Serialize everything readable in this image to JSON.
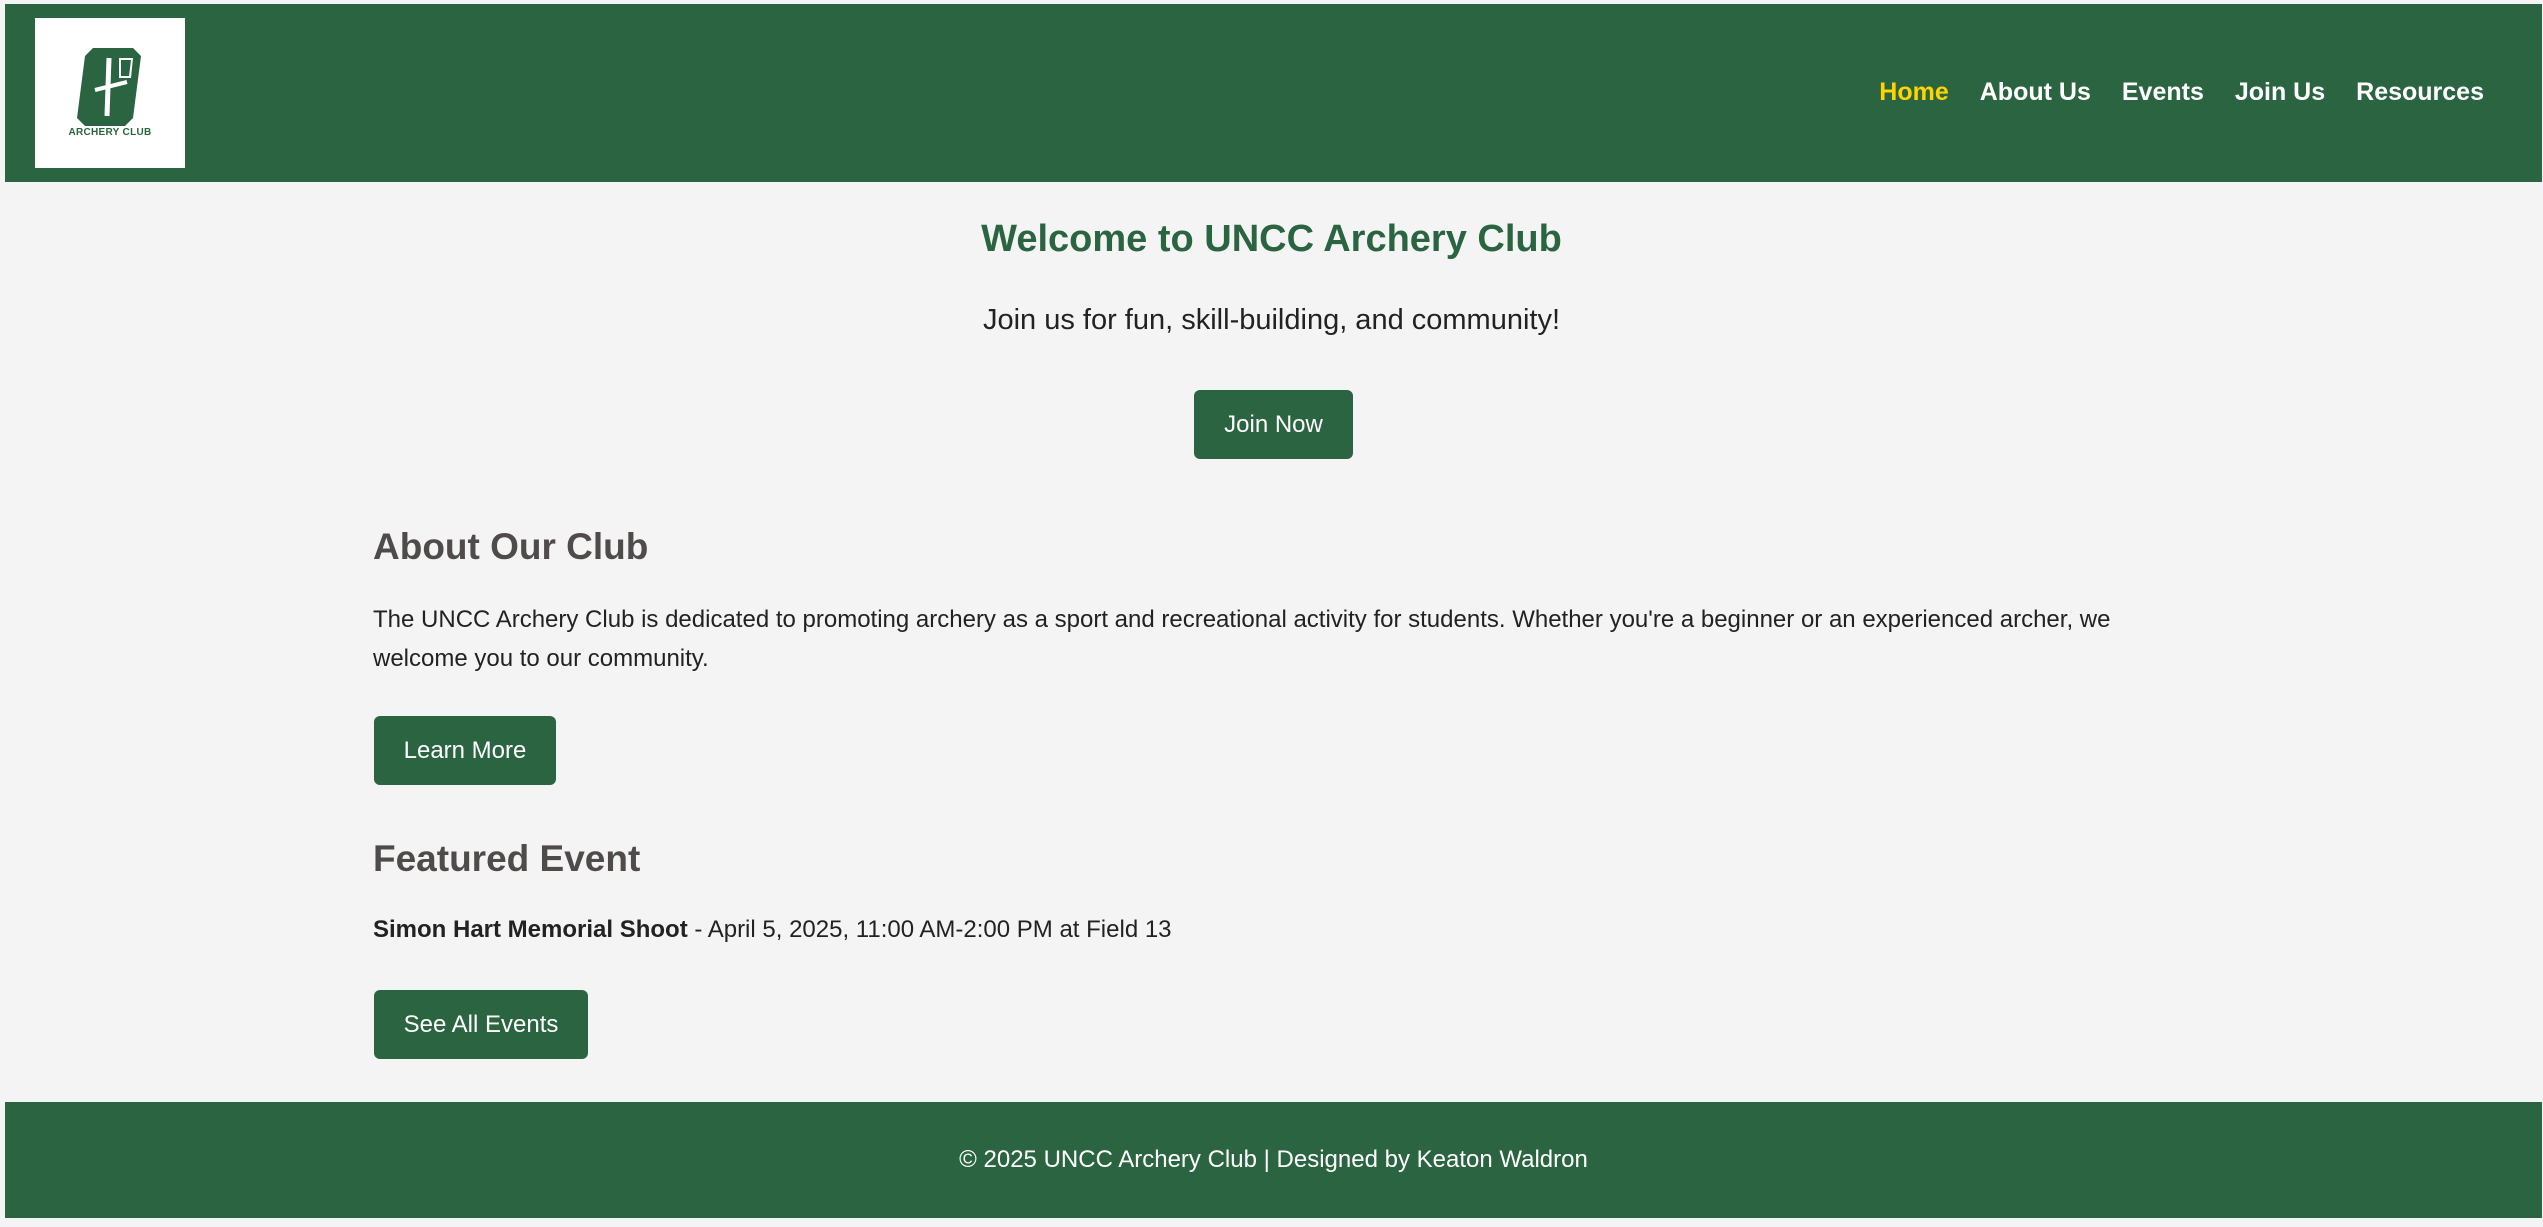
{
  "header": {
    "logo_icon": "uncc-archery-club-logo",
    "logo_caption": "ARCHERY CLUB",
    "nav": [
      {
        "label": "Home",
        "active": true
      },
      {
        "label": "About Us",
        "active": false
      },
      {
        "label": "Events",
        "active": false
      },
      {
        "label": "Join Us",
        "active": false
      },
      {
        "label": "Resources",
        "active": false
      }
    ]
  },
  "hero": {
    "title": "Welcome to UNCC Archery Club",
    "tagline": "Join us for fun, skill-building, and community!",
    "button_label": "Join Now"
  },
  "about": {
    "heading": "About Our Club",
    "text": "The UNCC Archery Club is dedicated to promoting archery as a sport and recreational activity for students. Whether you're a beginner or an experienced archer, we welcome you to our community.",
    "button_label": "Learn More"
  },
  "featured": {
    "heading": "Featured Event",
    "event_name": "Simon Hart Memorial Shoot",
    "event_details": " - April 5, 2025, 11:00 AM-2:00 PM at Field 13",
    "button_label": "See All Events"
  },
  "footer": {
    "text": "© 2025 UNCC Archery Club | Designed by Keaton Waldron"
  },
  "colors": {
    "brand_green": "#2b6440",
    "active_nav": "#ffd400",
    "background": "#f4f4f4",
    "heading_gray": "#4f4b4b"
  }
}
